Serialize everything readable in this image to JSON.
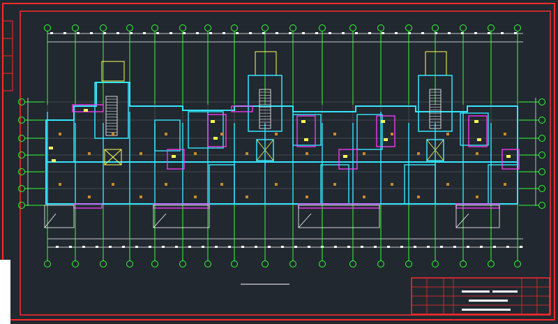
{
  "drawing": {
    "plan_caption": "",
    "title_block_heading": "",
    "revision_block_text": ""
  },
  "colors": {
    "background": "#212830",
    "border": "#ff2a2a",
    "grid_axis": "#35ff35",
    "wall": "#35e6ff",
    "partition": "#ff3cff",
    "fixture": "#ffff55",
    "furniture": "#c98a2a",
    "annotation": "#ffffff",
    "grid_line": "#6a6a6a"
  }
}
